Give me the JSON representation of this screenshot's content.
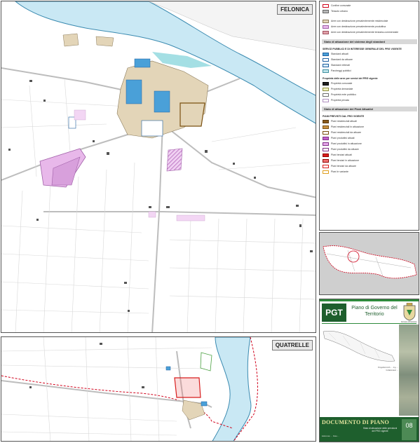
{
  "maps": {
    "felonica": {
      "label": "FELONICA"
    },
    "quatrelle": {
      "label": "QUATRELLE"
    }
  },
  "legend": {
    "rows_top": [
      {
        "text": "Confine comunale",
        "color": "#ffffff",
        "border": "#d0021b"
      },
      {
        "text": "Tessuto urbano",
        "color": "#b8b8b8",
        "border": "#666666"
      }
    ],
    "rows_attuaz": [
      {
        "text": "Aree con destinazione prevalentemente residenziale",
        "color": "#e3d5b8",
        "border": "#8a7a5a"
      },
      {
        "text": "Aree con destinazione prevalentemente produttiva",
        "color": "#e8b8ea",
        "border": "#a060a8"
      },
      {
        "text": "Aree con destinazione prevalentemente terziaria-commerciale",
        "color": "#e0a0a8",
        "border": "#a05060"
      }
    ],
    "head_standard": "Stato di attuazione del sistema degli standard",
    "sub_servizi": "SERVIZI PUBBLICI E DI INTERESSE GENERALE DEL PRG VIGENTE",
    "rows_servizi": [
      {
        "text": "Standard attuati",
        "color": "#4aa0d8",
        "border": "#2060a0"
      },
      {
        "text": "Standard da attuare",
        "color": "#ffffff",
        "border": "#2060a0"
      },
      {
        "text": "Standard reiterati",
        "color": "#d8ecf6",
        "border": "#2060a0"
      },
      {
        "text": "Parcheggi pubblici",
        "color": "#bfe4ea",
        "border": "#4090a0"
      }
    ],
    "sub_proprieta": "Proprietà delle aree per servizi del PRG vigente",
    "rows_proprieta": [
      {
        "text": "Proprietà comunale",
        "color": "#222222",
        "border": "#000000"
      },
      {
        "text": "Proprietà demaniale",
        "color": "#f0f0c0",
        "border": "#909040"
      },
      {
        "text": "Proprietà ente pubblico",
        "color": "#ffffff",
        "border": "#707070"
      },
      {
        "text": "Proprietà privata",
        "color": "#ffffff",
        "border": "#b090c0"
      }
    ],
    "head_piani": "Stato di attuazione dei Piani Attuativi",
    "sub_piani": "PIANI PREVISTI DAL PRG VIGENTE",
    "rows_piani": [
      {
        "text": "Piani residenziali attuati",
        "color": "#8a5a1a",
        "border": "#5a3a10"
      },
      {
        "text": "Piani residenziali in attuazione",
        "color": "#c89040",
        "border": "#7a5010"
      },
      {
        "text": "Piani residenziali da attuare",
        "color": "#ffffff",
        "border": "#7a5010"
      },
      {
        "text": "Piani produttivi attuati",
        "color": "#c060c8",
        "border": "#803088"
      },
      {
        "text": "Piani produttivi in attuazione",
        "color": "#e8a8ec",
        "border": "#803088"
      },
      {
        "text": "Piani produttivi da attuare",
        "color": "#ffffff",
        "border": "#803088"
      },
      {
        "text": "Piani terziari attuati",
        "color": "#d81e1e",
        "border": "#900000"
      },
      {
        "text": "Piani terziari in attuazione",
        "color": "#f07070",
        "border": "#900000"
      },
      {
        "text": "Piani terziari da attuare",
        "color": "#ffffff",
        "border": "#d81e1e"
      },
      {
        "text": "Piani in variante",
        "color": "#ffffff",
        "border": "#e0a020"
      }
    ]
  },
  "titleblock": {
    "pgt": "PGT",
    "title": "Piano di Governo del Territorio",
    "crest_caption": "Comune di Felonica",
    "credits": "Progettisti Arch. ... Ing. ... Collaboratori ...",
    "doc_title": "DOCUMENTO DI PIANO",
    "doc_subtitle": "Stato di attuazione delle previsioni del PRG vigente",
    "doc_number": "08",
    "doc_meta": "Elaborato ... Data ..."
  },
  "colors": {
    "river": "#c9e8f4",
    "river_edge": "#3a8ab0",
    "urban": "#e3d5b8",
    "productive": "#e8b8ea",
    "boundary": "#d0021b",
    "brand": "#1e5f2d"
  }
}
